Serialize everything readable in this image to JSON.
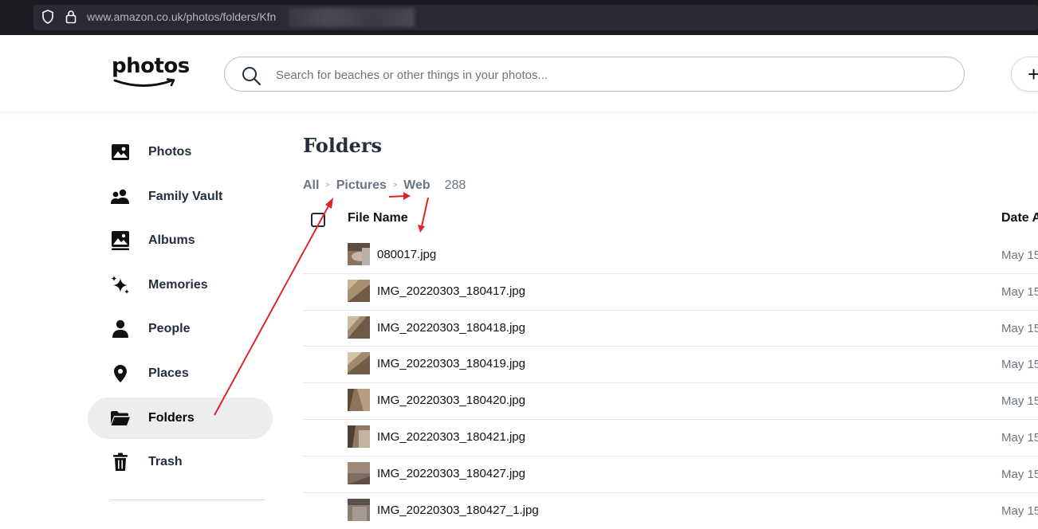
{
  "browser": {
    "url_host": "www.amazon.co.uk",
    "url_path": "/photos/folders/Kfn"
  },
  "header": {
    "logo_text": "photos",
    "search_placeholder": "Search for beaches or other things in your photos...",
    "add_button_label": "+"
  },
  "sidebar": {
    "items": [
      {
        "label": "Photos",
        "icon": "image-icon"
      },
      {
        "label": "Family Vault",
        "icon": "people-group-icon"
      },
      {
        "label": "Albums",
        "icon": "albums-icon"
      },
      {
        "label": "Memories",
        "icon": "sparkle-icon"
      },
      {
        "label": "People",
        "icon": "person-icon"
      },
      {
        "label": "Places",
        "icon": "location-pin-icon"
      },
      {
        "label": "Folders",
        "icon": "folder-icon",
        "active": true
      },
      {
        "label": "Trash",
        "icon": "trash-icon"
      }
    ]
  },
  "main": {
    "title": "Folders",
    "breadcrumb": [
      "All",
      "Pictures",
      "Web"
    ],
    "breadcrumb_separator": ">",
    "item_count": "288"
  },
  "table": {
    "columns": [
      "File Name",
      "Date A"
    ],
    "rows": [
      {
        "name": "080017.jpg",
        "date": "May 15"
      },
      {
        "name": "IMG_20220303_180417.jpg",
        "date": "May 15"
      },
      {
        "name": "IMG_20220303_180418.jpg",
        "date": "May 15"
      },
      {
        "name": "IMG_20220303_180419.jpg",
        "date": "May 15"
      },
      {
        "name": "IMG_20220303_180420.jpg",
        "date": "May 15"
      },
      {
        "name": "IMG_20220303_180421.jpg",
        "date": "May 15"
      },
      {
        "name": "IMG_20220303_180427.jpg",
        "date": "May 15"
      },
      {
        "name": "IMG_20220303_180427_1.jpg",
        "date": "May 15"
      }
    ]
  },
  "colors": {
    "annotation_arrow": "#e0262b",
    "active_nav_bg": "#eceded",
    "text_primary": "#232f3e",
    "text_secondary": "#6c7581"
  }
}
